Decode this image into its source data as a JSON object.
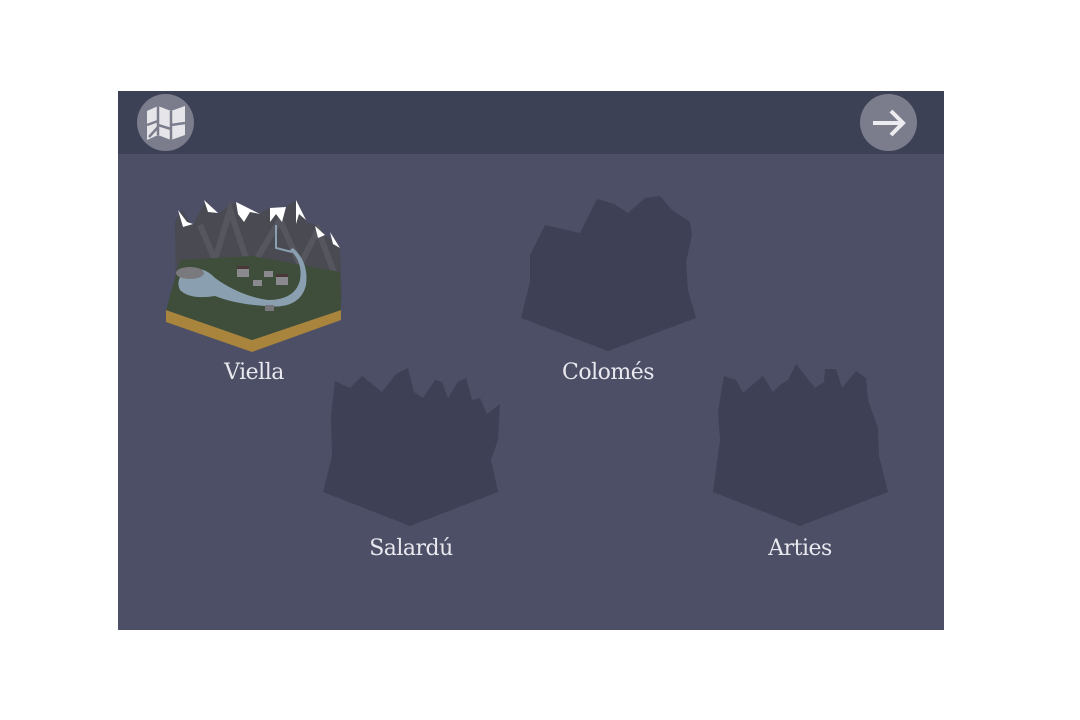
{
  "header": {
    "map_button_icon": "folded-map-icon",
    "next_button_icon": "arrow-right-icon"
  },
  "locations": [
    {
      "name": "Viella",
      "unlocked": true
    },
    {
      "name": "Colomés",
      "unlocked": false
    },
    {
      "name": "Salardú",
      "unlocked": false
    },
    {
      "name": "Arties",
      "unlocked": false
    }
  ],
  "colors": {
    "header": "#3d4156",
    "background": "#4c4f66",
    "locked_silhouette": "#3e4055",
    "button": "#7b7d8c"
  }
}
